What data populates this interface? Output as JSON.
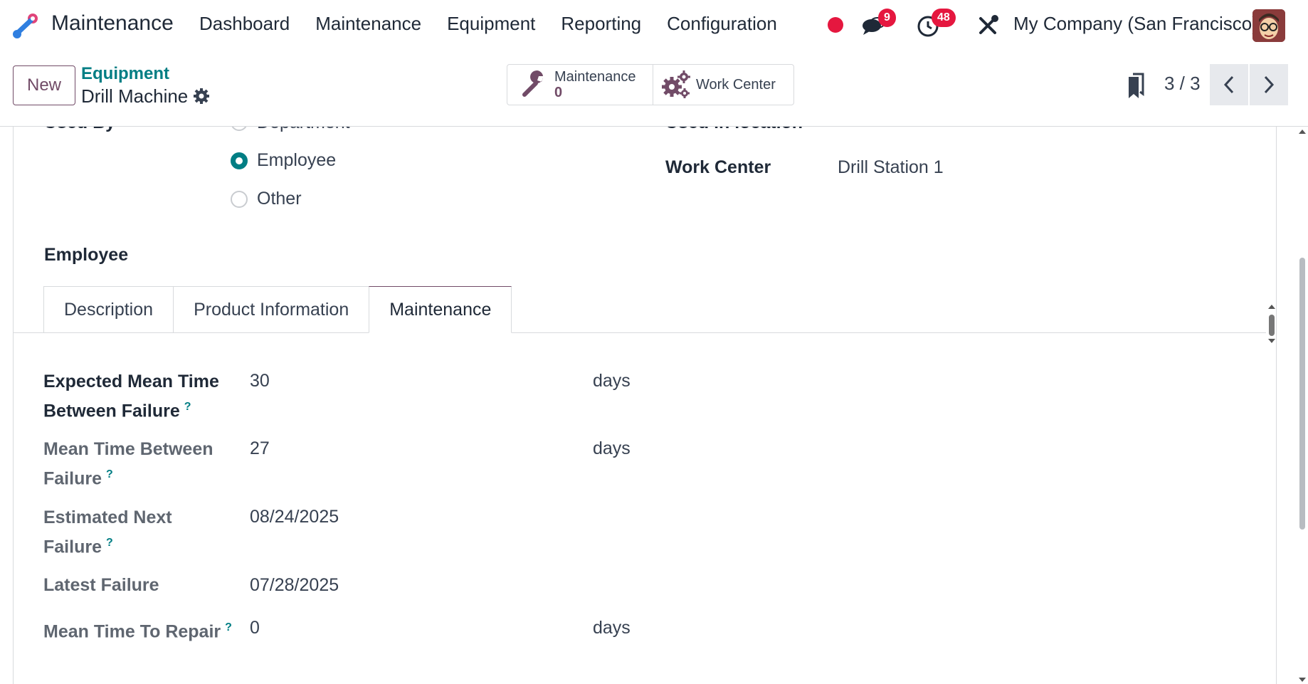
{
  "navbar": {
    "app_name": "Maintenance",
    "menu": [
      "Dashboard",
      "Maintenance",
      "Equipment",
      "Reporting",
      "Configuration"
    ],
    "messages_count": "9",
    "activities_count": "48",
    "company": "My Company (San Francisco)"
  },
  "control": {
    "new_label": "New",
    "breadcrumb_parent": "Equipment",
    "breadcrumb_current": "Drill Machine",
    "smart_maintenance_label": "Maintenance",
    "smart_maintenance_value": "0",
    "smart_workcenter_label": "Work Center",
    "pager": "3 / 3"
  },
  "form": {
    "used_by_label": "Used By",
    "used_by_options": [
      "Department",
      "Employee",
      "Other"
    ],
    "used_by_selected": "Employee",
    "used_in_location_label": "Used in location",
    "work_center_label": "Work Center",
    "work_center_value": "Drill Station 1",
    "employee_label": "Employee"
  },
  "tabs": [
    "Description",
    "Product Information",
    "Maintenance"
  ],
  "active_tab": "Maintenance",
  "maintenance": {
    "help_mark": "?",
    "expected_mtbf_label_1": "Expected Mean Time",
    "expected_mtbf_label_2": "Between Failure",
    "expected_mtbf_value": "30",
    "mtbf_label_1": "Mean Time Between",
    "mtbf_label_2": "Failure",
    "mtbf_value": "27",
    "next_failure_label_1": "Estimated Next",
    "next_failure_label_2": "Failure",
    "next_failure_value": "08/24/2025",
    "latest_failure_label": "Latest Failure",
    "latest_failure_value": "07/28/2025",
    "mttr_label": "Mean Time To Repair",
    "mttr_value": "0",
    "unit_days": "days"
  },
  "colors": {
    "brand": "#714b67",
    "accent": "#017e84",
    "badge": "#e5173f"
  }
}
